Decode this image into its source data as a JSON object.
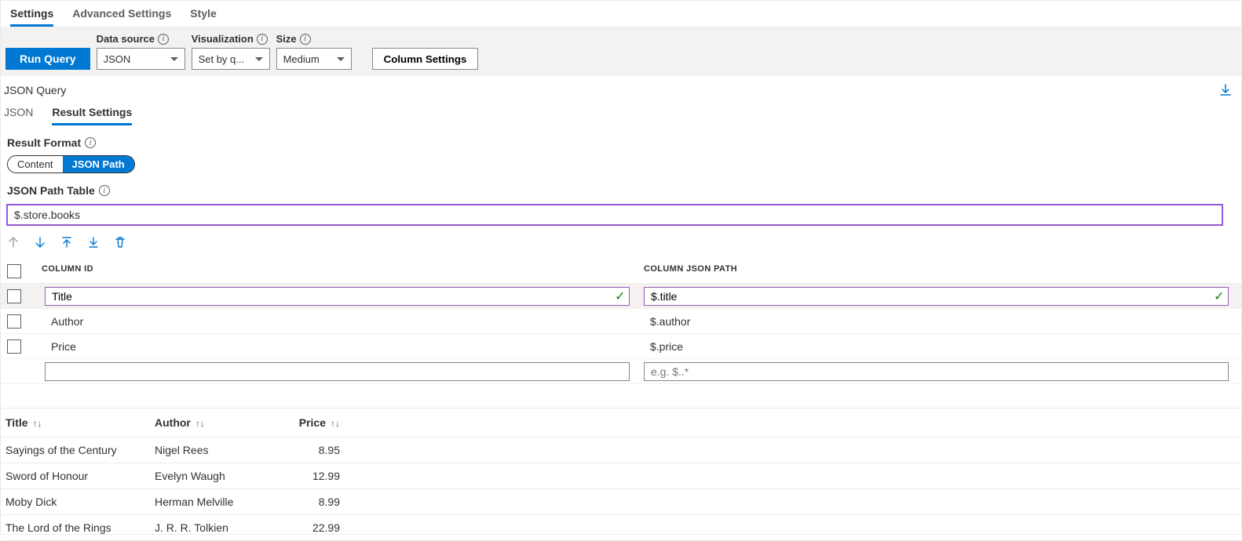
{
  "topTabs": {
    "items": [
      "Settings",
      "Advanced Settings",
      "Style"
    ],
    "activeIndex": 0
  },
  "toolbar": {
    "run": "Run Query",
    "dataSourceLabel": "Data source",
    "dataSourceValue": "JSON",
    "vizLabel": "Visualization",
    "vizValue": "Set by q...",
    "sizeLabel": "Size",
    "sizeValue": "Medium",
    "columnSettings": "Column Settings"
  },
  "jsonQueryLabel": "JSON Query",
  "subTabs": {
    "items": [
      "JSON",
      "Result Settings"
    ],
    "activeIndex": 1
  },
  "resultFormat": {
    "label": "Result Format",
    "options": [
      "Content",
      "JSON Path"
    ],
    "activeIndex": 1
  },
  "jsonPathTable": {
    "label": "JSON Path Table",
    "value": "$.store.books"
  },
  "columnHeaders": {
    "id": "COLUMN ID",
    "path": "COLUMN JSON PATH"
  },
  "columnDefs": [
    {
      "id": "Title",
      "path": "$.title",
      "editing": true
    },
    {
      "id": "Author",
      "path": "$.author",
      "editing": false
    },
    {
      "id": "Price",
      "path": "$.price",
      "editing": false
    }
  ],
  "newRow": {
    "idPlaceholder": "",
    "pathPlaceholder": "e.g. $..*"
  },
  "resultHeaders": [
    "Title",
    "Author",
    "Price"
  ],
  "resultRows": [
    {
      "title": "Sayings of the Century",
      "author": "Nigel Rees",
      "price": "8.95"
    },
    {
      "title": "Sword of Honour",
      "author": "Evelyn Waugh",
      "price": "12.99"
    },
    {
      "title": "Moby Dick",
      "author": "Herman Melville",
      "price": "8.99"
    },
    {
      "title": "The Lord of the Rings",
      "author": "J. R. R. Tolkien",
      "price": "22.99"
    }
  ]
}
